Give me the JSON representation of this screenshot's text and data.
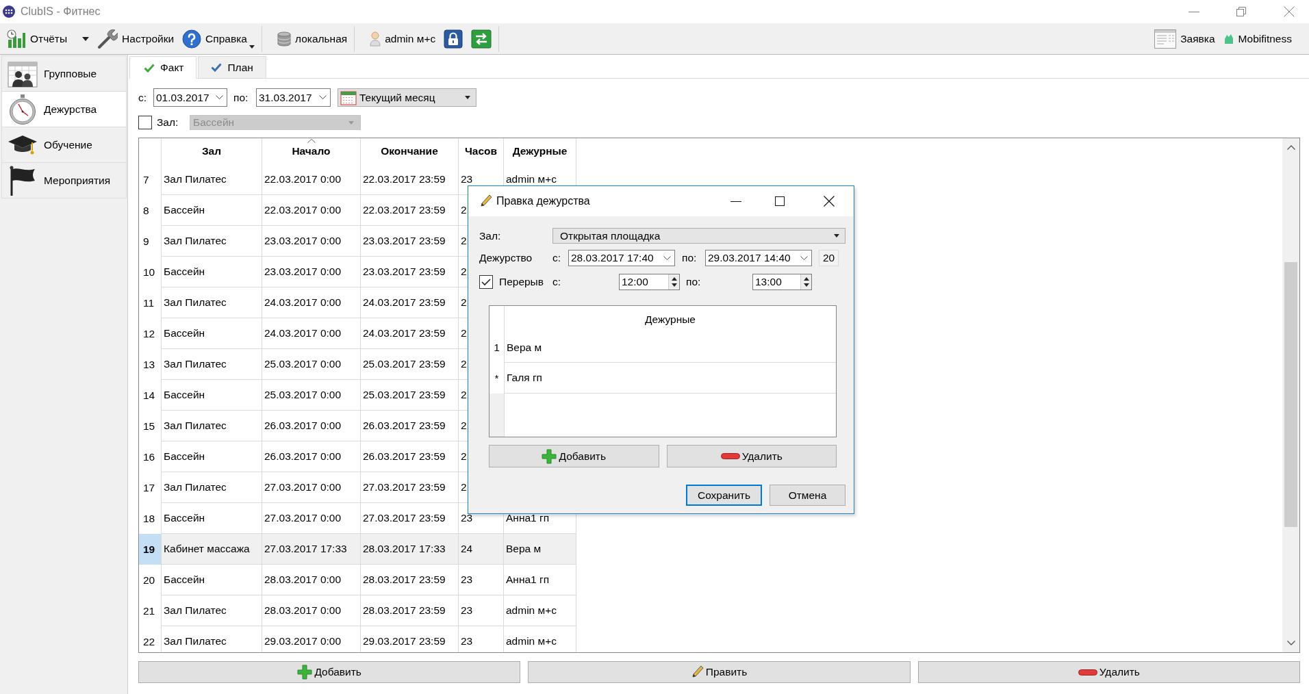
{
  "window": {
    "title": "ClubIS - Фитнес"
  },
  "toolbar": {
    "groups": [
      [
        {
          "kind": "split",
          "label": "Отчёты"
        },
        {
          "kind": "button",
          "label": "Настройки"
        },
        {
          "kind": "dropdown",
          "label": "Справка"
        }
      ],
      [
        {
          "kind": "button",
          "label": "локальная"
        }
      ],
      [
        {
          "kind": "button",
          "label": "admin м+с"
        },
        {
          "kind": "icon_button"
        },
        {
          "kind": "icon_button"
        }
      ]
    ],
    "right": [
      {
        "kind": "button",
        "label": "Заявка"
      },
      {
        "kind": "button",
        "label": "Mobifitness"
      }
    ]
  },
  "sidebar": {
    "items": [
      {
        "label": "Групповые",
        "selected": false
      },
      {
        "label": "Дежурства",
        "selected": true
      },
      {
        "label": "Обучение",
        "selected": false
      },
      {
        "label": "Мероприятия",
        "selected": false
      }
    ]
  },
  "tabs": [
    {
      "label": "Факт",
      "selected": true
    },
    {
      "label": "План",
      "selected": false
    }
  ],
  "filters": {
    "from_label": "с:",
    "from": "01.03.2017",
    "to_label": "по:",
    "to": "31.03.2017",
    "period": "Текущий месяц",
    "hall": {
      "checked": false,
      "label": "Зал:",
      "value": "Бассейн",
      "disabled": true
    }
  },
  "table": {
    "columns": [
      {
        "label": "Зал",
        "sorted": false
      },
      {
        "label": "Начало",
        "sorted": true
      },
      {
        "label": "Окончание",
        "sorted": false
      },
      {
        "label": "Часов",
        "sorted": false
      },
      {
        "label": "Дежурные",
        "sorted": false
      }
    ],
    "rows": [
      {
        "number": "7",
        "cells": [
          "Зал Пилатес",
          "22.03.2017 0:00",
          "22.03.2017 23:59",
          "23",
          "admin м+с"
        ],
        "selected": false
      },
      {
        "number": "8",
        "cells": [
          "Бассейн",
          "22.03.2017 0:00",
          "22.03.2017 23:59",
          "2"
        ],
        "selected": false
      },
      {
        "number": "9",
        "cells": [
          "Зал Пилатес",
          "23.03.2017 0:00",
          "23.03.2017 23:59",
          "2"
        ],
        "selected": false
      },
      {
        "number": "10",
        "cells": [
          "Бассейн",
          "23.03.2017 0:00",
          "23.03.2017 23:59",
          "2"
        ],
        "selected": false
      },
      {
        "number": "11",
        "cells": [
          "Зал Пилатес",
          "24.03.2017 0:00",
          "24.03.2017 23:59",
          "2"
        ],
        "selected": false
      },
      {
        "number": "12",
        "cells": [
          "Бассейн",
          "24.03.2017 0:00",
          "24.03.2017 23:59",
          "2"
        ],
        "selected": false
      },
      {
        "number": "13",
        "cells": [
          "Зал Пилатес",
          "25.03.2017 0:00",
          "25.03.2017 23:59",
          "2"
        ],
        "selected": false
      },
      {
        "number": "14",
        "cells": [
          "Бассейн",
          "25.03.2017 0:00",
          "25.03.2017 23:59",
          "2"
        ],
        "selected": false
      },
      {
        "number": "15",
        "cells": [
          "Зал Пилатес",
          "26.03.2017 0:00",
          "26.03.2017 23:59",
          "2"
        ],
        "selected": false
      },
      {
        "number": "16",
        "cells": [
          "Бассейн",
          "26.03.2017 0:00",
          "26.03.2017 23:59",
          "2"
        ],
        "selected": false
      },
      {
        "number": "17",
        "cells": [
          "Зал Пилатес",
          "27.03.2017 0:00",
          "27.03.2017 23:59",
          "2"
        ],
        "selected": false
      },
      {
        "number": "18",
        "cells": [
          "Бассейн",
          "27.03.2017 0:00",
          "27.03.2017 23:59",
          "23",
          "Анна1 гп"
        ],
        "selected": false
      },
      {
        "number": "19",
        "cells": [
          "Кабинет массажа",
          "27.03.2017 17:33",
          "28.03.2017 17:33",
          "24",
          "Вера м"
        ],
        "selected": true
      },
      {
        "number": "20",
        "cells": [
          "Бассейн",
          "28.03.2017 0:00",
          "28.03.2017 23:59",
          "23",
          "Анна1 гп"
        ],
        "selected": false
      },
      {
        "number": "21",
        "cells": [
          "Зал Пилатес",
          "28.03.2017 0:00",
          "28.03.2017 23:59",
          "23",
          "admin м+с"
        ],
        "selected": false
      },
      {
        "number": "22",
        "cells": [
          "Зал Пилатес",
          "29.03.2017 0:00",
          "29.03.2017 23:59",
          "23",
          "admin м+с"
        ],
        "selected": false
      }
    ]
  },
  "buttons": [
    "Добавить",
    "Править",
    "Удалить"
  ],
  "dialog": {
    "title": "Правка дежурства",
    "hall_label": "Зал:",
    "hall": "Открытая площадка",
    "duty_label": "Дежурство",
    "from_label": "с:",
    "from": "28.03.2017 17:40",
    "to_label": "по:",
    "to": "29.03.2017 14:40",
    "hours": "20",
    "break": {
      "checked": true,
      "label": "Перерыв",
      "from_label": "с:",
      "from": "12:00",
      "to_label": "по:",
      "to": "13:00"
    },
    "staff_table": {
      "column": "Дежурные",
      "rows": [
        {
          "marker": "1",
          "name": "Вера м"
        },
        {
          "marker": "*",
          "name": "Галя гп"
        }
      ]
    },
    "list_buttons": [
      "Добавить",
      "Удалить"
    ],
    "footer_buttons": [
      {
        "label": "Сохранить",
        "focused": true
      },
      {
        "label": "Отмена",
        "focused": false
      }
    ]
  }
}
